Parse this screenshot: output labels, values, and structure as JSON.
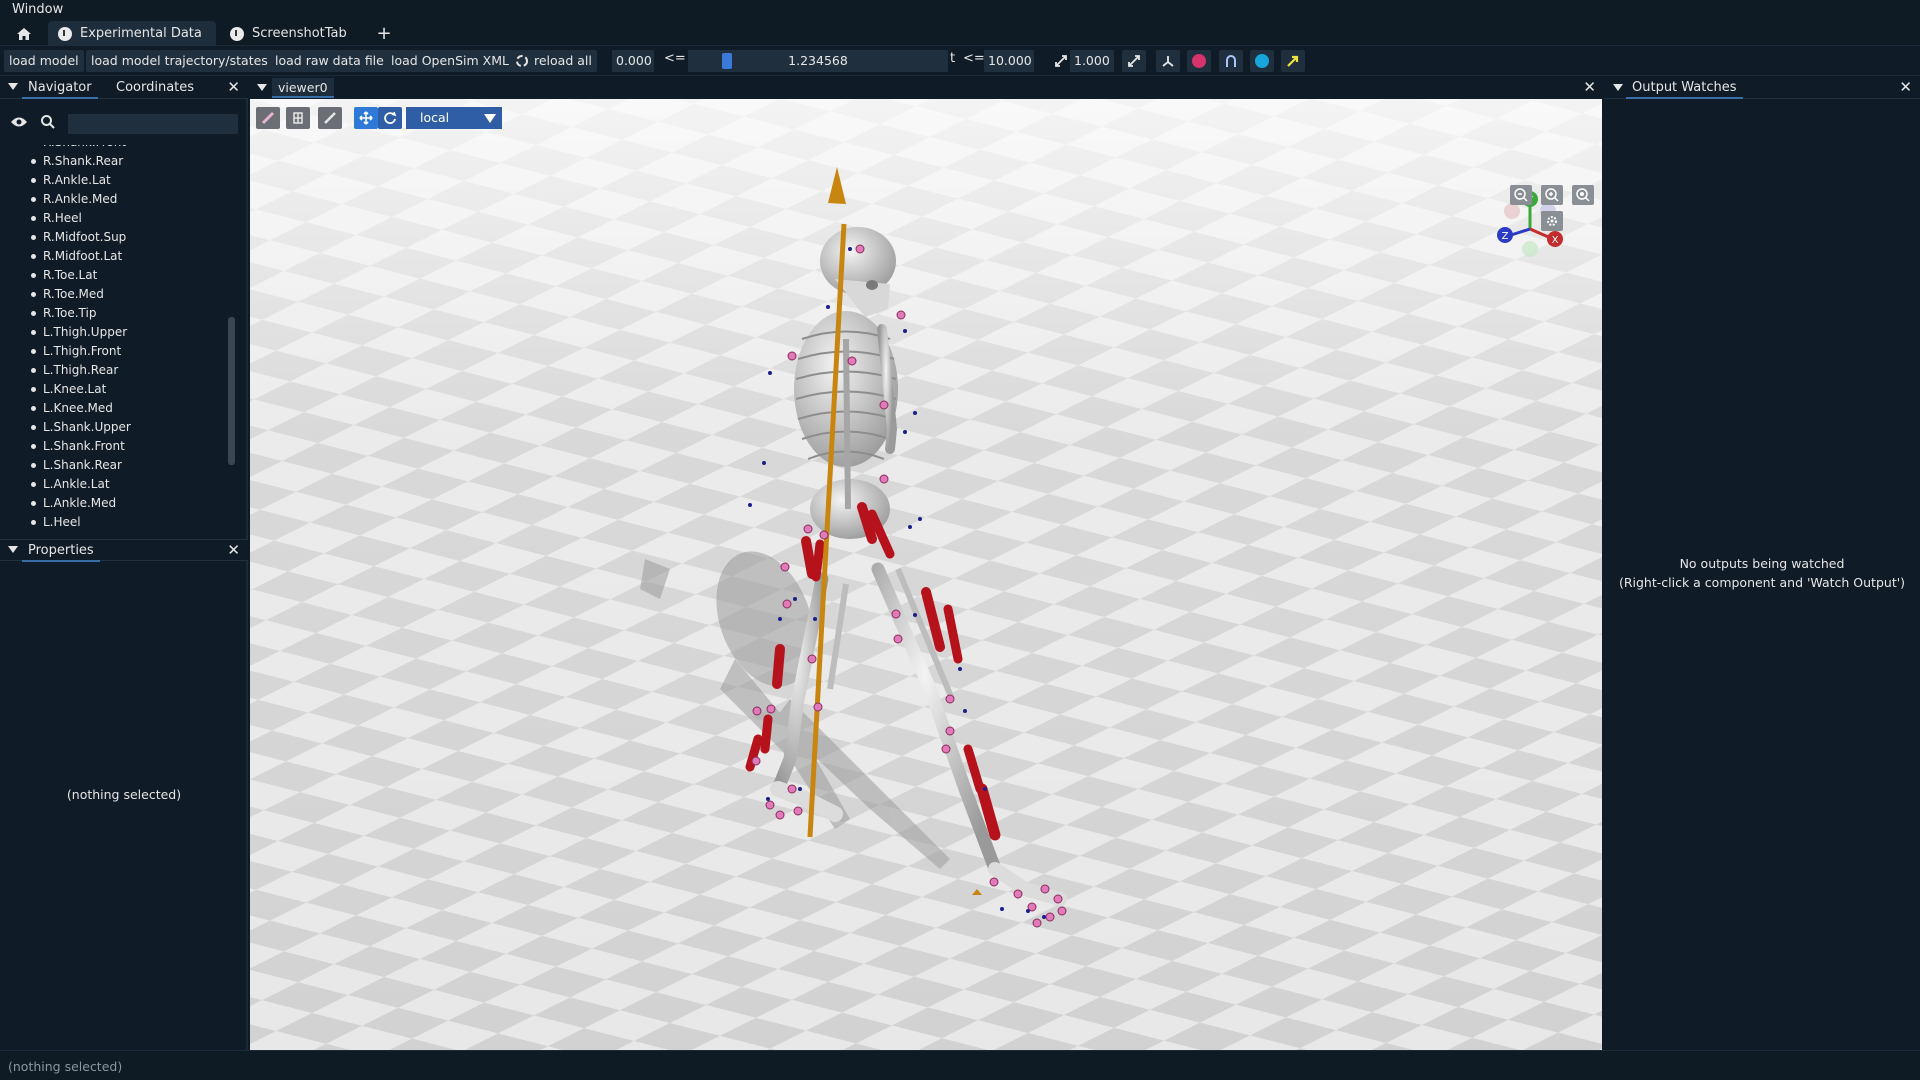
{
  "menubar": {
    "window_label": "Window"
  },
  "tabs": [
    {
      "label": "Experimental Data",
      "active": true
    },
    {
      "label": "ScreenshotTab",
      "active": false
    }
  ],
  "toolbar": {
    "load_model": "load model",
    "load_trajectory": "load model trajectory/states",
    "load_raw": "load raw data file",
    "load_xml": "load OpenSim XML",
    "reload_all": "reload all",
    "t_start": "0.000",
    "le1": "<=",
    "t_current": "1.234568",
    "t_label": "t",
    "le2": "<=",
    "t_end": "10.000",
    "playback_speed": "1.000"
  },
  "navigator": {
    "tab_navigator": "Navigator",
    "tab_coordinates": "Coordinates",
    "items": [
      "R.Shank.Front",
      "R.Shank.Rear",
      "R.Ankle.Lat",
      "R.Ankle.Med",
      "R.Heel",
      "R.Midfoot.Sup",
      "R.Midfoot.Lat",
      "R.Toe.Lat",
      "R.Toe.Med",
      "R.Toe.Tip",
      "L.Thigh.Upper",
      "L.Thigh.Front",
      "L.Thigh.Rear",
      "L.Knee.Lat",
      "L.Knee.Med",
      "L.Shank.Upper",
      "L.Shank.Front",
      "L.Shank.Rear",
      "L.Ankle.Lat",
      "L.Ankle.Med",
      "L.Heel"
    ]
  },
  "properties": {
    "title": "Properties",
    "empty": "(nothing selected)"
  },
  "viewer": {
    "tab_label": "viewer0",
    "frame_mode": "local",
    "axes": [
      "Y",
      "X",
      "Z"
    ]
  },
  "output_watches": {
    "title": "Output Watches",
    "empty_line1": "No outputs being watched",
    "empty_line2": "(Right-click a component and 'Watch Output')"
  },
  "status": {
    "text": "(nothing selected)"
  },
  "colors": {
    "accent": "#3a7ad9",
    "panel_bg": "#0f1b26",
    "muscle": "#b5121b",
    "marker": "#e07ab8"
  }
}
